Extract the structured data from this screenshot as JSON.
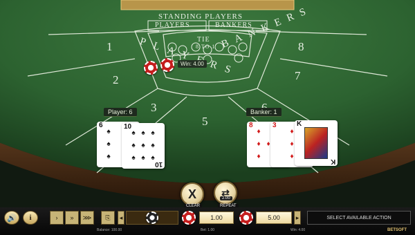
{
  "table": {
    "header_title": "STANDING PLAYERS",
    "players_tab": "PLAYERS",
    "bankers_tab": "BANKERS",
    "tie_label": "TIE",
    "tie_odds": "8 TO 1",
    "player_word": "PLAYERS",
    "banker_word": "BANKERS",
    "seat_numbers": [
      "1",
      "2",
      "3",
      "5",
      "6",
      "7",
      "8"
    ]
  },
  "win_label": "Win: 4.00",
  "player_hand": {
    "label": "Player: 6",
    "cards": [
      {
        "rank": "6",
        "suit": "♠",
        "color": "black"
      },
      {
        "rank": "10",
        "suit": "♠",
        "color": "black"
      }
    ]
  },
  "banker_hand": {
    "label": "Banker: 1",
    "cards": [
      {
        "rank": "8",
        "suit": "♦",
        "color": "red"
      },
      {
        "rank": "3",
        "suit": "♦",
        "color": "red"
      },
      {
        "rank": "K",
        "suit": "♠",
        "color": "black"
      }
    ]
  },
  "buttons": {
    "clear_icon": "X",
    "clear_label": "CLEAR",
    "repeat_value": "2.00",
    "repeat_label": "REPEAT"
  },
  "bottom_bar": {
    "sound_icon": "speaker-icon",
    "info_icon": "i",
    "speed_1": "›",
    "speed_2": "»",
    "speed_3": "⋙",
    "bet_value_1": "1.00",
    "bet_value_2": "5.00",
    "status_text": "SELECT AVAILABLE ACTION",
    "brand": "BETSOFT",
    "balance_caption": "Balance: 100.00",
    "bet_caption": "Bet: 1.00",
    "win_caption": "Win: 4.00"
  }
}
